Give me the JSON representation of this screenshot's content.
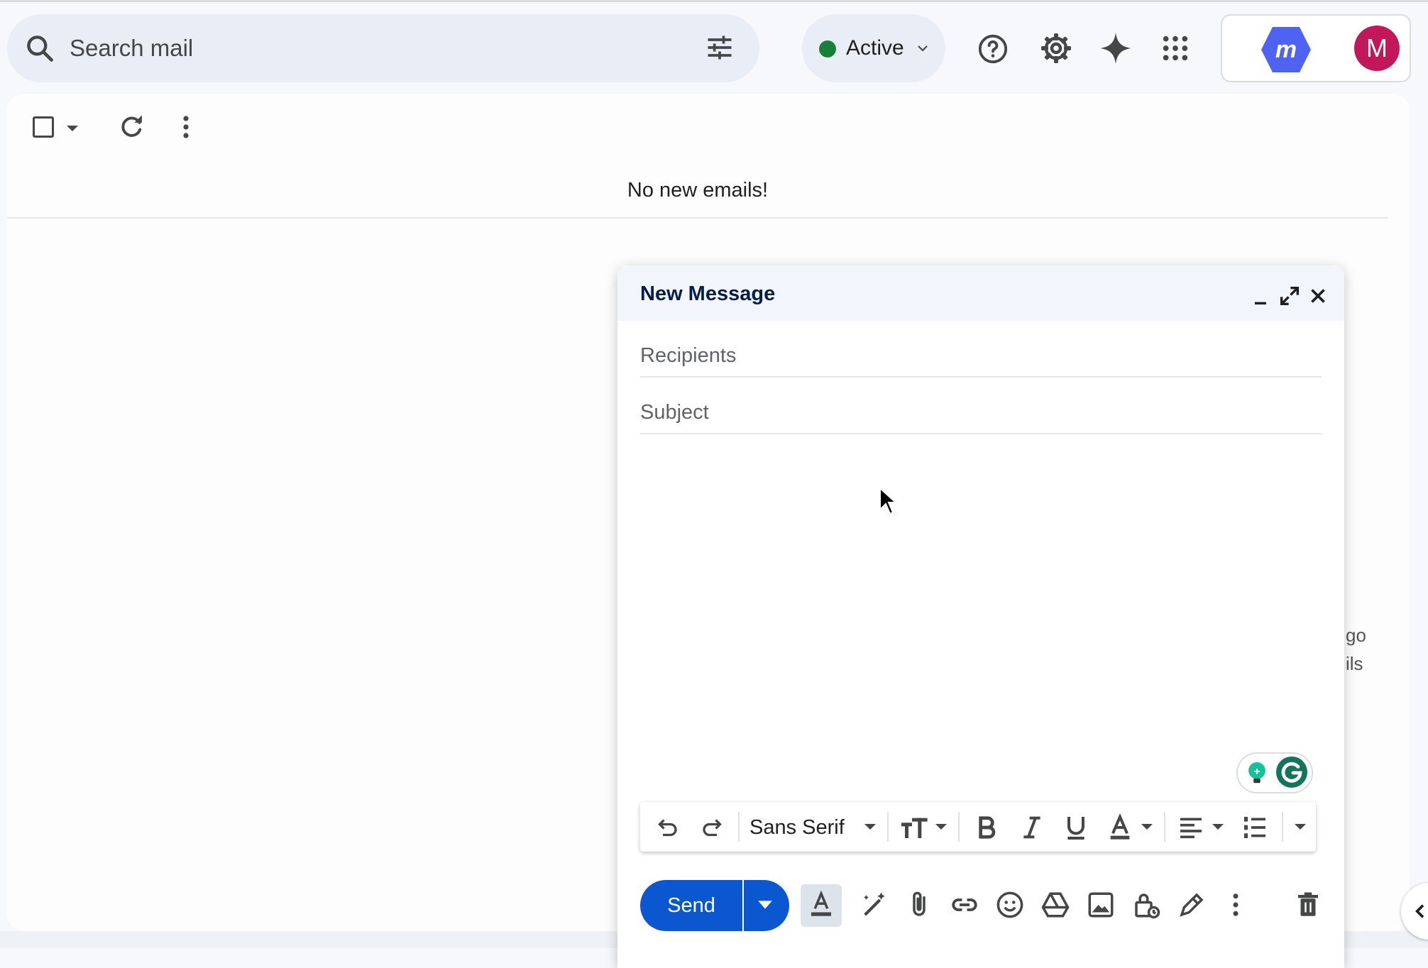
{
  "header": {
    "search_placeholder": "Search mail",
    "status_label": "Active",
    "status_color": "#188038",
    "icons": [
      "search-icon",
      "filter-icon",
      "help-icon",
      "gear-icon",
      "gemini-spark-icon",
      "apps-grid-icon"
    ],
    "avatar_initial": "M",
    "avatar_color": "#c2185b",
    "extension_logo_color": "#4f63f2"
  },
  "toolbar": {
    "icons": [
      "checkbox",
      "caret-down-icon",
      "refresh-icon",
      "more-vert-icon"
    ]
  },
  "main": {
    "empty_message": "No new emails!",
    "clipped_text_1": "go",
    "clipped_text_2": "ils"
  },
  "compose": {
    "title": "New Message",
    "recipients_placeholder": "Recipients",
    "subject_placeholder": "Subject",
    "font_name": "Sans Serif",
    "send_label": "Send",
    "accent_color": "#0b57d0"
  }
}
